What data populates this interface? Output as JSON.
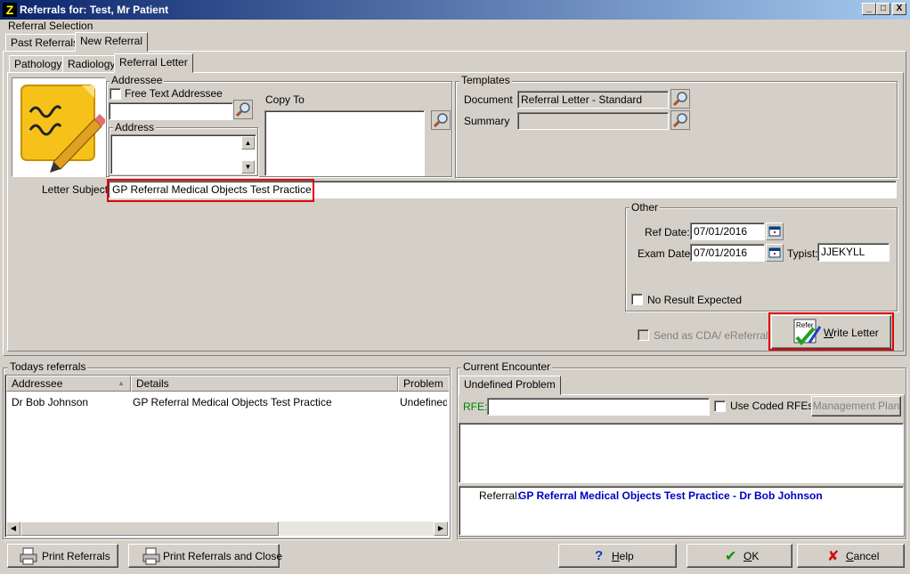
{
  "window": {
    "title": "Referrals for: Test, Mr Patient",
    "minimize": "_",
    "maximize": "□",
    "close": "X"
  },
  "referral_selection": {
    "label": "Referral Selection",
    "tabs": [
      "Past Referrals",
      "New Referral"
    ],
    "active_tab": "New Referral"
  },
  "sub_tabs": {
    "items": [
      "Pathology",
      "Radiology",
      "Referral Letter"
    ],
    "active": "Referral Letter"
  },
  "addressee": {
    "group_label": "Addressee",
    "free_text_label": "Free Text Addressee",
    "free_text_checked": false,
    "value": "",
    "address_label": "Address",
    "address_value": ""
  },
  "copy_to": {
    "label": "Copy To",
    "value": ""
  },
  "templates": {
    "group_label": "Templates",
    "document_label": "Document",
    "document_value": "Referral Letter - Standard",
    "summary_label": "Summary",
    "summary_value": ""
  },
  "letter_subject": {
    "label": "Letter Subject:",
    "value": "GP Referral Medical Objects Test Practice"
  },
  "other": {
    "group_label": "Other",
    "ref_date_label": "Ref Date:",
    "ref_date": "07/01/2016",
    "exam_date_label": "Exam Date:",
    "exam_date": "07/01/2016",
    "typist_label": "Typist:",
    "typist": "JJEKYLL",
    "no_result_label": "No Result Expected",
    "no_result_checked": false
  },
  "send_cda": {
    "label": "Send as CDA/ eReferral",
    "checked": false
  },
  "write_letter": {
    "label_underlined": "W",
    "label_rest": "rite Letter",
    "icon_text": "Refer"
  },
  "todays_referrals": {
    "label": "Todays referrals",
    "columns": [
      "Addressee",
      "Details",
      "Problem"
    ],
    "rows": [
      {
        "addressee": "Dr Bob Johnson",
        "details": "GP Referral Medical Objects Test Practice",
        "problem": "Undefined Problem"
      }
    ]
  },
  "current_encounter": {
    "label": "Current Encounter",
    "tab": "Undefined Problem",
    "rfe_label": "RFE:",
    "rfe_value": "",
    "use_coded_label": "Use Coded RFEs",
    "use_coded_checked": false,
    "management_plan": "Management Plan",
    "referral_label": "Referral:",
    "referral_text": "GP Referral Medical Objects Test Practice - Dr Bob Johnson"
  },
  "footer": {
    "print_referrals": "Print Referrals",
    "print_close": "Print Referrals and Close",
    "help": {
      "u": "H",
      "rest": "elp"
    },
    "ok": {
      "u": "O",
      "rest": "K"
    },
    "cancel": {
      "u": "C",
      "rest": "ancel"
    }
  },
  "colors": {
    "title_start": "#0a246a",
    "title_end": "#a6caf0",
    "highlight": "#e00000",
    "referral_text": "#0000c0",
    "rfe_label": "#008000"
  }
}
